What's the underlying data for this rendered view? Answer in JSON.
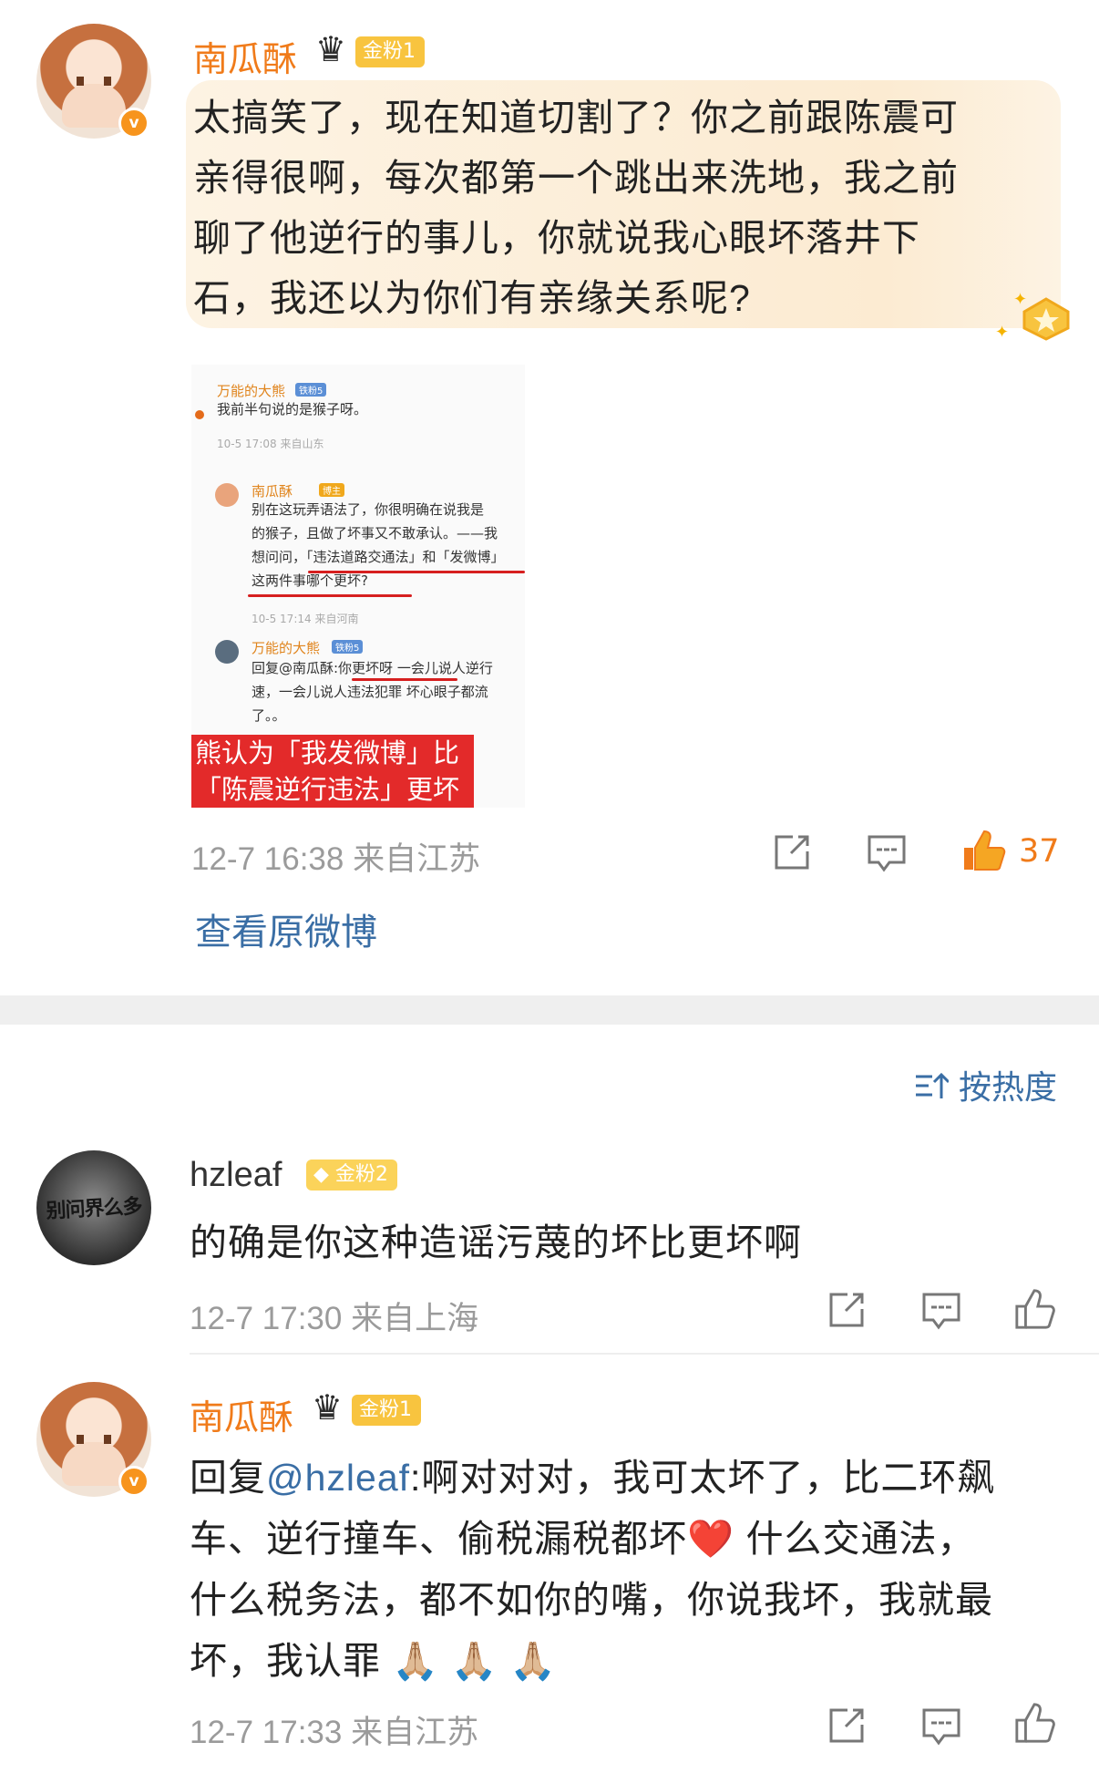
{
  "post": {
    "username": "南瓜酥",
    "verified_mark": "v",
    "fan_badge": "金粉1",
    "lines": [
      "太搞笑了，现在知道切割了？你之前跟陈震可",
      "亲得很啊，每次都第一个跳出来洗地，我之前",
      "聊了他逆行的事儿，你就说我心眼坏落井下",
      "石，我还以为你们有亲缘关系呢?"
    ],
    "embedded": {
      "c1_name": "万能的大熊",
      "c1_badge": "铁粉5",
      "c1_text": "我前半句说的是猴子呀。",
      "c1_meta": "10-5 17:08 来自山东",
      "c2_name": "南瓜酥",
      "c2_badge": "博主",
      "c2_lines": [
        "别在这玩弄语法了，你很明确在说我是",
        "的猴子，且做了坏事又不敢承认。——我",
        "想问问，「违法道路交通法」和「发微博」",
        "这两件事哪个更坏?"
      ],
      "c2_meta": "10-5 17:14 来自河南",
      "c3_name": "万能的大熊",
      "c3_badge": "铁粉5",
      "c3_lines": [
        "回复@南瓜酥:你更坏呀 一会儿说人逆行",
        "速，一会儿说人违法犯罪 坏心眼子都流",
        "了。。"
      ],
      "banner_lines": [
        "熊认为「我发微博」比",
        "「陈震逆行违法」更坏"
      ]
    },
    "time": "12-7 16:38",
    "location": "来自江苏",
    "like_count": "37",
    "view_original": "查看原微博"
  },
  "sort_label": "按热度",
  "replies": [
    {
      "username": "hzleaf",
      "avatar_text": "别问界么多",
      "fan_badge": "金粉2",
      "text": "的确是你这种造谣污蔑的坏比更坏啊",
      "time": "12-7 17:30",
      "location": "来自上海"
    },
    {
      "username": "南瓜酥",
      "verified_mark": "v",
      "fan_badge": "金粉1",
      "reply_prefix": "回复",
      "mention": "@hzleaf",
      "line1": ":啊对对对，我可太坏了，比二环飙",
      "line2": "车、逆行撞车、偷税漏税都坏",
      "heart": "❤️",
      "line2b": " 什么交通法，",
      "line3": "什么税务法，都不如你的嘴，你说我坏，我就最",
      "line4": "坏，我认罪",
      "emoji": "🙏🏼 🙏🏼 🙏🏼",
      "time": "12-7 17:33",
      "location": "来自江苏"
    }
  ],
  "colors": {
    "accent_orange": "#f07b1a",
    "link_blue": "#3a6ea5",
    "meta_gray": "#9b9b9b",
    "highlight_bg": "#fcebd2",
    "badge_gold": "#f8c43f"
  },
  "icons": [
    "share-icon",
    "comment-icon",
    "like-icon",
    "sort-icon",
    "crown-icon"
  ]
}
